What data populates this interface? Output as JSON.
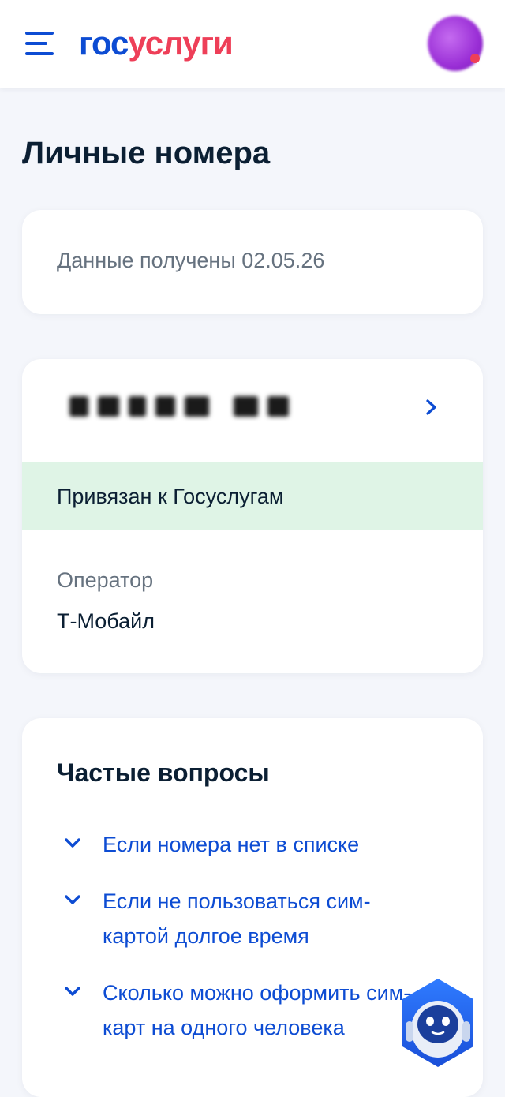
{
  "header": {
    "logo_part1": "гос",
    "logo_part2": "услуги",
    "menu_icon": "hamburger-menu-icon",
    "avatar_icon": "user-avatar-icon"
  },
  "page": {
    "title": "Личные номера"
  },
  "info_card": {
    "text": "Данные получены 02.05.26"
  },
  "number_card": {
    "status": "Привязан к Госуслугам",
    "operator_label": "Оператор",
    "operator_value": "Т-Мобайл",
    "status_color": "#dff4e6"
  },
  "faq": {
    "title": "Частые вопросы",
    "items": [
      {
        "text": "Если номера нет в списке"
      },
      {
        "text": "Если не пользоваться сим-картой долгое время"
      },
      {
        "text": "Сколько можно оформить сим-карт на одного человека"
      }
    ]
  },
  "colors": {
    "brand_blue": "#0d4cd3",
    "brand_red": "#ee3f58",
    "background": "#f4f6fb",
    "muted_text": "#66727f"
  }
}
